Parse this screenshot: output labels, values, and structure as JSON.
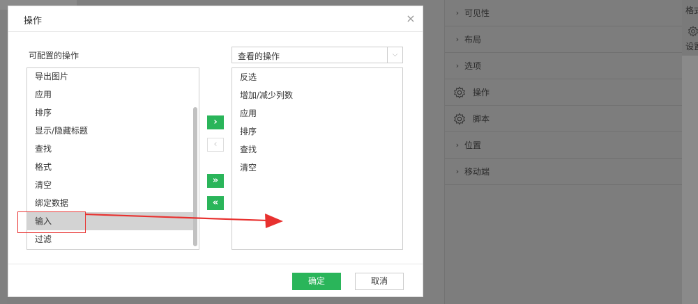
{
  "background": {
    "right_panel": {
      "rows": [
        {
          "label": "可见性",
          "icon": "chevron-right-icon"
        },
        {
          "label": "布局",
          "icon": "chevron-right-icon"
        },
        {
          "label": "选项",
          "icon": "chevron-right-icon"
        },
        {
          "label": "操作",
          "icon": "gear-icon"
        },
        {
          "label": "脚本",
          "icon": "gear-icon"
        },
        {
          "label": "位置",
          "icon": "chevron-right-icon"
        },
        {
          "label": "移动端",
          "icon": "chevron-right-icon"
        }
      ]
    },
    "far_right": {
      "label_top": "格式",
      "label_settings": "设置"
    }
  },
  "dialog": {
    "title": "操作",
    "close_icon": "×",
    "configurable_label": "可配置的操作",
    "view_select": {
      "selected": "查看的操作",
      "arrow": "⌵"
    },
    "available_items": [
      {
        "label": "导出图片"
      },
      {
        "label": "应用"
      },
      {
        "label": "排序"
      },
      {
        "label": "显示/隐藏标题"
      },
      {
        "label": "查找"
      },
      {
        "label": "格式"
      },
      {
        "label": "清空"
      },
      {
        "label": "绑定数据"
      },
      {
        "label": "输入",
        "selected": true
      },
      {
        "label": "过滤"
      }
    ],
    "selected_items": [
      {
        "label": "反选"
      },
      {
        "label": "增加/减少列数"
      },
      {
        "label": "应用"
      },
      {
        "label": "排序"
      },
      {
        "label": "查找"
      },
      {
        "label": "清空"
      }
    ],
    "transfer_buttons": {
      "add_one": "›",
      "remove_one": "‹",
      "add_all": "»",
      "remove_all": "«"
    },
    "ok_label": "确定",
    "cancel_label": "取消"
  },
  "colors": {
    "accent_green": "#2ab55a",
    "annotation_red": "#e8312f",
    "selected_row": "#d3d3d3"
  }
}
